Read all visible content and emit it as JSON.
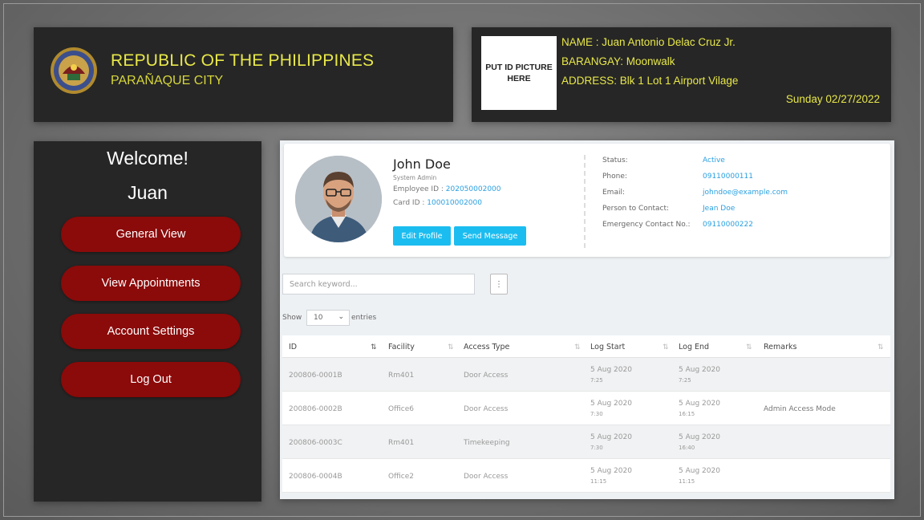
{
  "header": {
    "title": "REPUBLIC OF THE PHILIPPINES",
    "subtitle": "PARAÑAQUE CITY",
    "id_placeholder": "PUT ID PICTURE HERE",
    "name_line": "NAME : Juan Antonio Delac Cruz Jr.",
    "barangay_line": "BARANGAY: Moonwalk",
    "address_line": "ADDRESS: Blk 1 Lot 1 Airport Vilage",
    "date_line": "Sunday  02/27/2022"
  },
  "sidebar": {
    "welcome": "Welcome!",
    "user": "Juan",
    "items": [
      {
        "label": "General View"
      },
      {
        "label": "View Appointments"
      },
      {
        "label": "Account Settings"
      },
      {
        "label": "Log Out"
      }
    ]
  },
  "profile": {
    "name": "John Doe",
    "role": "System Admin",
    "employee_id_label": "Employee ID : ",
    "employee_id": "202050002000",
    "card_id_label": "Card ID : ",
    "card_id": "100010002000",
    "edit_button": "Edit Profile",
    "message_button": "Send Message",
    "details": [
      {
        "label": "Status:",
        "value": "Active"
      },
      {
        "label": "Phone:",
        "value": "09110000111"
      },
      {
        "label": "Email:",
        "value": "johndoe@example.com"
      },
      {
        "label": "Person to Contact:",
        "value": "Jean Doe"
      },
      {
        "label": "Emergency Contact No.:",
        "value": "09110000222"
      }
    ]
  },
  "table_controls": {
    "search_placeholder": "Search keyword...",
    "show_label": "Show",
    "entries_value": "10",
    "entries_label": "entries"
  },
  "table": {
    "columns": [
      "ID",
      "Facility",
      "Access Type",
      "Log Start",
      "Log End",
      "Remarks"
    ],
    "rows": [
      {
        "id": "200806-0001B",
        "facility": "Rm401",
        "access": "Door Access",
        "start_date": "5 Aug 2020",
        "start_time": "7:25",
        "end_date": "5 Aug 2020",
        "end_time": "7:25",
        "remarks": ""
      },
      {
        "id": "200806-0002B",
        "facility": "Office6",
        "access": "Door Access",
        "start_date": "5 Aug 2020",
        "start_time": "7:30",
        "end_date": "5 Aug 2020",
        "end_time": "16:15",
        "remarks": "Admin Access Mode"
      },
      {
        "id": "200806-0003C",
        "facility": "Rm401",
        "access": "Timekeeping",
        "start_date": "5 Aug 2020",
        "start_time": "7:30",
        "end_date": "5 Aug 2020",
        "end_time": "16:40",
        "remarks": ""
      },
      {
        "id": "200806-0004B",
        "facility": "Office2",
        "access": "Door Access",
        "start_date": "5 Aug 2020",
        "start_time": "11:15",
        "end_date": "5 Aug 2020",
        "end_time": "11:15",
        "remarks": ""
      }
    ]
  }
}
